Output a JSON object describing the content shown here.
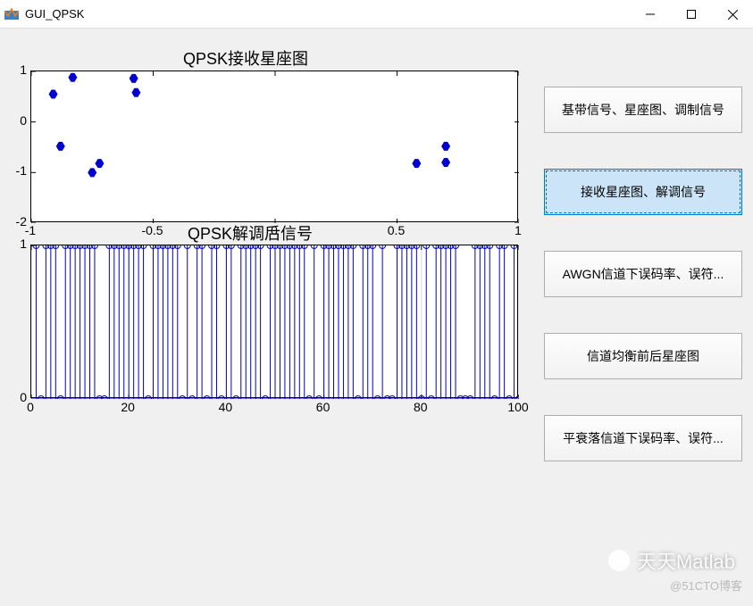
{
  "window": {
    "title": "GUI_QPSK"
  },
  "buttons": [
    {
      "label": "基带信号、星座图、调制信号",
      "selected": false
    },
    {
      "label": "接收星座图、解调信号",
      "selected": true
    },
    {
      "label": "AWGN信道下误码率、误符...",
      "selected": false
    },
    {
      "label": "信道均衡前后星座图",
      "selected": false
    },
    {
      "label": "平衰落信道下误码率、误符...",
      "selected": false
    }
  ],
  "chart_data": [
    {
      "type": "scatter",
      "title": "QPSK接收星座图",
      "xlabel": "",
      "ylabel": "",
      "xlim": [
        -1,
        1
      ],
      "ylim": [
        -2,
        1
      ],
      "xticks": [
        -1,
        -0.5,
        0,
        0.5,
        1
      ],
      "yticks": [
        -2,
        -1,
        0,
        1
      ],
      "points": [
        {
          "x": -0.91,
          "y": 0.55
        },
        {
          "x": -0.83,
          "y": 0.88
        },
        {
          "x": -0.88,
          "y": -0.48
        },
        {
          "x": -0.72,
          "y": -0.82
        },
        {
          "x": -0.75,
          "y": -1.0
        },
        {
          "x": -0.57,
          "y": 0.58
        },
        {
          "x": -0.58,
          "y": 0.86
        },
        {
          "x": 0.58,
          "y": -0.82
        },
        {
          "x": 0.7,
          "y": -0.8
        },
        {
          "x": 0.7,
          "y": -0.48
        }
      ]
    },
    {
      "type": "stem",
      "title": "QPSK解调后信号",
      "xlabel": "",
      "ylabel": "",
      "xlim": [
        0,
        100
      ],
      "ylim": [
        0,
        1
      ],
      "xticks": [
        0,
        20,
        40,
        60,
        80,
        100
      ],
      "yticks": [
        0,
        1
      ],
      "x": [
        1,
        2,
        3,
        4,
        5,
        6,
        7,
        8,
        9,
        10,
        11,
        12,
        13,
        14,
        15,
        16,
        17,
        18,
        19,
        20,
        21,
        22,
        23,
        24,
        25,
        26,
        27,
        28,
        29,
        30,
        31,
        32,
        33,
        34,
        35,
        36,
        37,
        38,
        39,
        40,
        41,
        42,
        43,
        44,
        45,
        46,
        47,
        48,
        49,
        50,
        51,
        52,
        53,
        54,
        55,
        56,
        57,
        58,
        59,
        60,
        61,
        62,
        63,
        64,
        65,
        66,
        67,
        68,
        69,
        70,
        71,
        72,
        73,
        74,
        75,
        76,
        77,
        78,
        79,
        80,
        81,
        82,
        83,
        84,
        85,
        86,
        87,
        88,
        89,
        90,
        91,
        92,
        93,
        94,
        95,
        96,
        97,
        98,
        99,
        100
      ],
      "y": [
        1,
        0,
        1,
        1,
        1,
        0,
        1,
        1,
        1,
        1,
        1,
        1,
        1,
        0,
        0,
        1,
        1,
        1,
        1,
        1,
        1,
        1,
        1,
        0,
        1,
        1,
        1,
        1,
        1,
        1,
        0,
        1,
        0,
        1,
        1,
        0,
        1,
        1,
        0,
        1,
        1,
        0,
        1,
        1,
        1,
        1,
        1,
        0,
        1,
        1,
        1,
        1,
        1,
        1,
        1,
        1,
        0,
        1,
        0,
        1,
        1,
        1,
        1,
        1,
        1,
        1,
        0,
        1,
        1,
        1,
        0,
        1,
        0,
        0,
        1,
        1,
        1,
        1,
        1,
        0,
        1,
        0,
        1,
        1,
        1,
        1,
        1,
        0,
        0,
        0,
        1,
        1,
        1,
        1,
        0,
        1,
        1,
        0,
        1,
        0
      ]
    }
  ],
  "watermark": {
    "text1": "天天Matlab",
    "text2": "@51CTO博客"
  }
}
